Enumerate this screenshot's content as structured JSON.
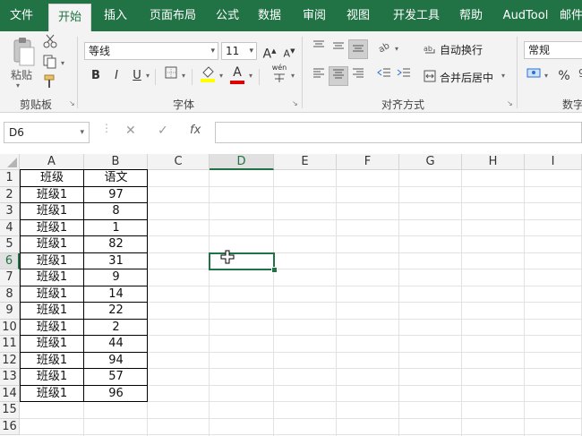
{
  "menu": {
    "tabs": [
      "文件",
      "开始",
      "插入",
      "页面布局",
      "公式",
      "数据",
      "审阅",
      "视图",
      "开发工具",
      "帮助",
      "AudTool",
      "邮件"
    ],
    "active": "开始"
  },
  "ribbon": {
    "clipboard": {
      "paste_label": "粘贴",
      "group_label": "剪贴板"
    },
    "font": {
      "font_name": "等线",
      "font_size": "11",
      "grow": "A",
      "shrink": "A",
      "bold": "B",
      "italic": "I",
      "underline": "U",
      "group_label": "字体",
      "pinyin_label": "wén",
      "font_color_label": "A"
    },
    "alignment": {
      "wrap_label": "自动换行",
      "merge_label": "合并后居中",
      "group_label": "对齐方式"
    },
    "number": {
      "format": "常规",
      "percent": "%",
      "group_label": "数字"
    }
  },
  "formula_bar": {
    "name_box": "D6",
    "cancel": "✕",
    "confirm": "✓",
    "fx": "fx",
    "value": ""
  },
  "grid": {
    "columns": [
      "A",
      "B",
      "C",
      "D",
      "E",
      "F",
      "G",
      "H",
      "I"
    ],
    "rows": [
      "1",
      "2",
      "3",
      "4",
      "5",
      "6",
      "7",
      "8",
      "9",
      "10",
      "11",
      "12",
      "13",
      "14",
      "15",
      "16"
    ],
    "selected_cell": "D6",
    "table": {
      "headers": [
        "班级",
        "语文"
      ],
      "rows": [
        [
          "班级1",
          "97"
        ],
        [
          "班级1",
          "8"
        ],
        [
          "班级1",
          "1"
        ],
        [
          "班级1",
          "82"
        ],
        [
          "班级1",
          "31"
        ],
        [
          "班级1",
          "9"
        ],
        [
          "班级1",
          "14"
        ],
        [
          "班级1",
          "22"
        ],
        [
          "班级1",
          "2"
        ],
        [
          "班级1",
          "44"
        ],
        [
          "班级1",
          "94"
        ],
        [
          "班级1",
          "57"
        ],
        [
          "班级1",
          "96"
        ]
      ]
    }
  },
  "colors": {
    "accent": "#217346",
    "font_color_bar": "#e00000",
    "highlight_bar": "#ffff00"
  }
}
